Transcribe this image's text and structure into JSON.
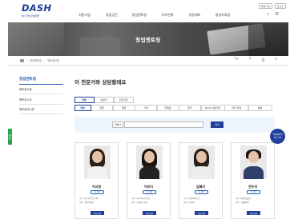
{
  "header": {
    "logo": "DASH",
    "logo_sub": "by 아산나눔재단",
    "util": [
      "회원가입",
      "로그인"
    ],
    "nav": [
      "지원사업",
      "창업공간",
      "창업멘토링",
      "투자연계",
      "성장레포",
      "창업자료실"
    ],
    "icons": [
      "search-icon",
      "menu-icon"
    ]
  },
  "banner": {
    "title": "창업멘토링"
  },
  "breadcrumb": {
    "items": [
      "창업멘토링",
      "멘토링신청"
    ],
    "tools": [
      "T+",
      "T-",
      "print-icon",
      "share-icon"
    ]
  },
  "sidebar": {
    "title": "창업멘토링",
    "items": [
      "멘토링신청",
      "멘토리스트",
      "멘토링게시판"
    ]
  },
  "main": {
    "heading": "이 전문가와 상담할래요",
    "tabs1": [
      "전체",
      "유세미",
      "오토미안"
    ],
    "tabs2": [
      "전체",
      "창업",
      "경영",
      "기술",
      "마케팅",
      "투자",
      "R&D/지원사업",
      "세무·회계",
      "법률"
    ],
    "search": {
      "select": "전체",
      "button": "검색"
    }
  },
  "mentors": [
    {
      "name": "이서영",
      "badge": "전 분야",
      "desc1": "소속 : ㈜스타트업코리아",
      "desc2": "분야 : 경영·마케팅",
      "button": "상담신청"
    },
    {
      "name": "이유지",
      "badge": "전 분야",
      "desc1": "소속 : ㈜디자인스튜디오",
      "desc2": "분야 : 브랜딩·디자인",
      "button": "상담신청"
    },
    {
      "name": "김혜지",
      "badge": "전 분야",
      "desc1": "소속 : ㈜벤처파트너스",
      "desc2": "분야 : 투자·IR",
      "button": "상담신청"
    },
    {
      "name": "전우석",
      "badge": "전 분야",
      "desc1": "소속 : ㈜테크솔루션",
      "desc2": "분야 : 기술·R&D",
      "button": "상담신청"
    }
  ],
  "floating": {
    "right": "마이페이지\n바로가기",
    "left": "메뉴"
  },
  "colors": {
    "brand": "#1f3f9a",
    "accent": "#1f5ab5",
    "green": "#2aa44a"
  }
}
